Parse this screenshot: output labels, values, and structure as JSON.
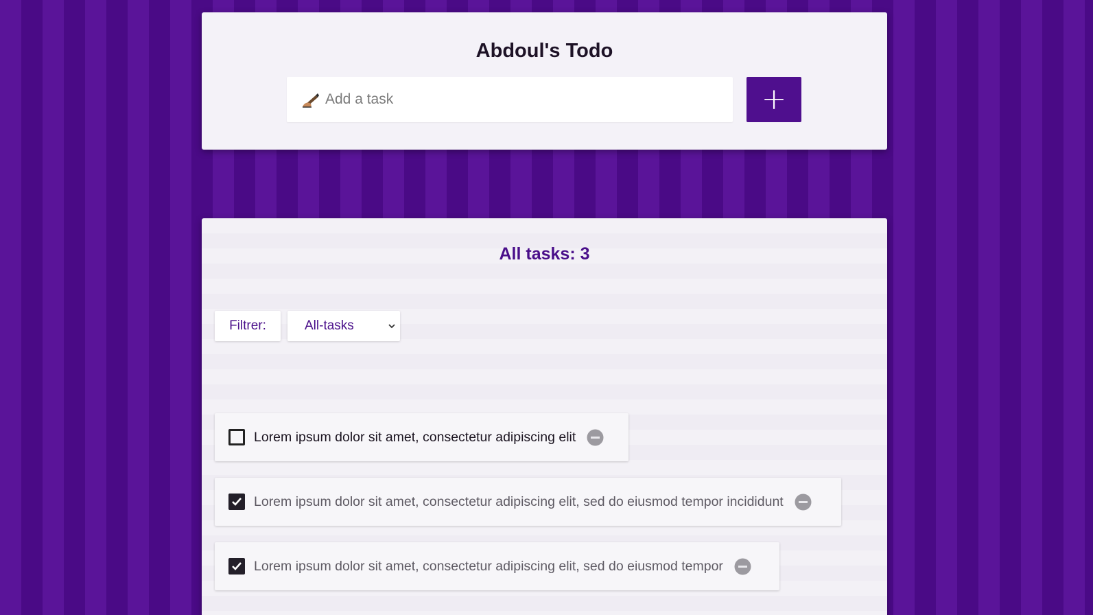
{
  "header": {
    "title": "Abdoul's Todo",
    "input_placeholder": "Add a task",
    "add_button_label": "+",
    "pen_icon": "writing-hand-icon"
  },
  "tasks_panel": {
    "heading": "All tasks: 3",
    "filter_label": "Filtrer:",
    "filter_selected": "All-tasks",
    "items": [
      {
        "text": "Lorem ipsum dolor sit amet, consectetur adipiscing elit",
        "done": false
      },
      {
        "text": "Lorem ipsum dolor sit amet, consectetur adipiscing elit, sed do eiusmod tempor incididunt",
        "done": true
      },
      {
        "text": "Lorem ipsum dolor sit amet, consectetur adipiscing elit, sed do eiusmod tempor",
        "done": true
      }
    ]
  },
  "colors": {
    "accent": "#4f0f8e",
    "background": "#4e0b8c",
    "delete_icon": "#9c9aa0"
  }
}
